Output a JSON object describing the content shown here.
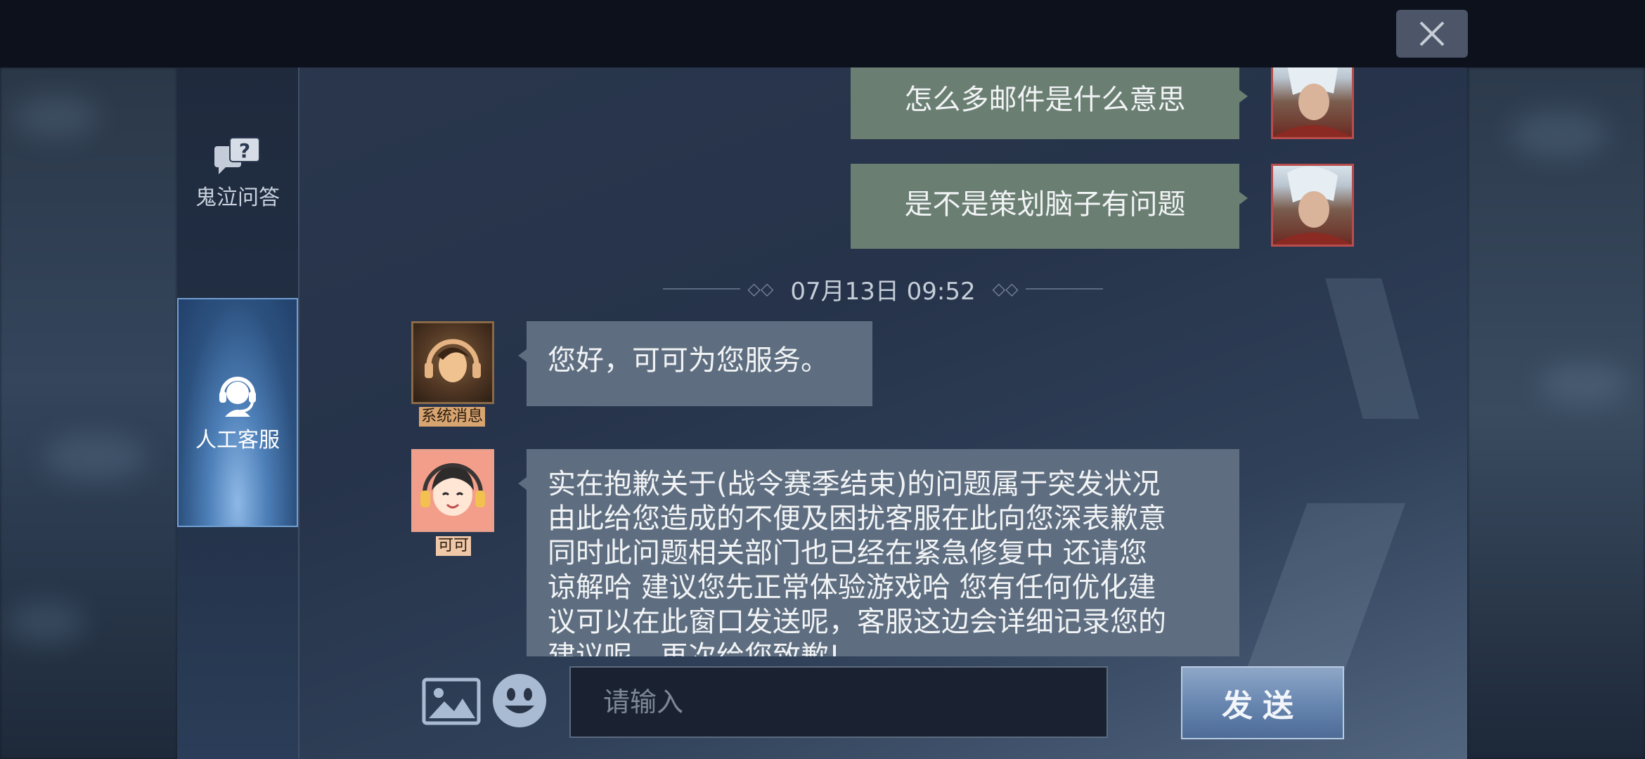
{
  "window": {
    "close_icon": "close-icon"
  },
  "sidebar": {
    "items": [
      {
        "label": "鬼泣问答",
        "icon": "question-bubble-icon",
        "active": false
      },
      {
        "label": "人工客服",
        "icon": "headset-agent-icon",
        "active": true
      }
    ]
  },
  "chat": {
    "timestamp": "07月13日 09:52",
    "messages": [
      {
        "from": "user",
        "text": "怎么多邮件是什么意思"
      },
      {
        "from": "user",
        "text": "是不是策划脑子有问题"
      },
      {
        "from": "system",
        "tag": "系统消息",
        "text": "您好，可可为您服务。"
      },
      {
        "from": "keke",
        "tag": "可可",
        "lines": [
          "实在抱歉关于(战令赛季结束)的问题属于突发状况",
          "由此给您造成的不便及困扰客服在此向您深表歉意",
          "同时此问题相关部门也已经在紧急修复中 还请您",
          "谅解哈 建议您先正常体验游戏哈 您有任何优化建",
          "议可以在此窗口发送呢，客服这边会详细记录您的",
          "建议呢，再次给您致歉!"
        ]
      }
    ]
  },
  "input_bar": {
    "image_icon": "image-icon",
    "emoji_icon": "emoji-icon",
    "placeholder": "请输入",
    "value": "",
    "send_label": "发送"
  }
}
